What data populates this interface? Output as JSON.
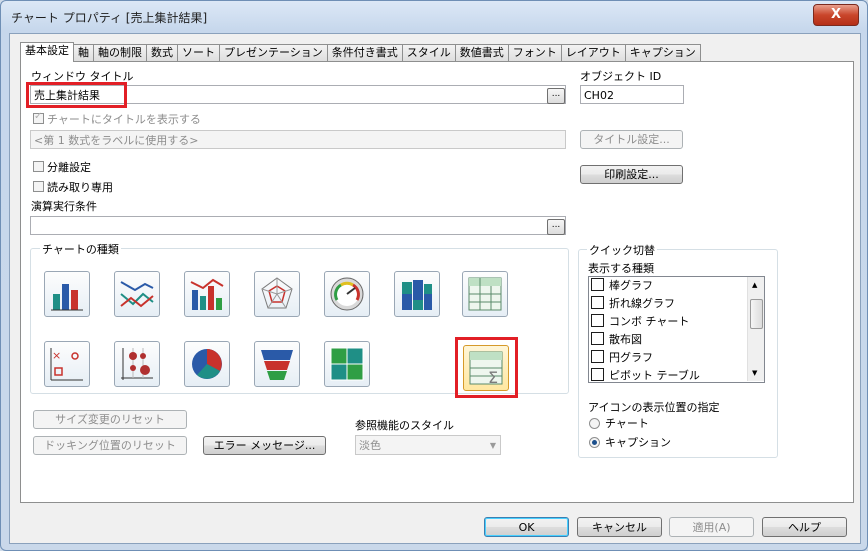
{
  "window": {
    "title": "チャート プロパティ [売上集計結果]",
    "close_label": "X"
  },
  "tabs": [
    "基本設定",
    "軸",
    "軸の制限",
    "数式",
    "ソート",
    "プレゼンテーション",
    "条件付き書式",
    "スタイル",
    "数値書式",
    "フォント",
    "レイアウト",
    "キャプション"
  ],
  "active_tab": "基本設定",
  "window_title_section": {
    "label": "ウィンドウ タイトル",
    "value": "売上集計結果",
    "browse": "..."
  },
  "object_id": {
    "label": "オブジェクト ID",
    "value": "CH02"
  },
  "show_title": {
    "label": "チャートにタイトルを表示する",
    "checked": true,
    "disabled": true
  },
  "title_field": {
    "placeholder": "<第 1 数式をラベルに使用する>"
  },
  "buttons": {
    "title_settings": "タイトル設定...",
    "print_settings": "印刷設定...",
    "resize_reset": "サイズ変更のリセット",
    "docking_reset": "ドッキング位置のリセット",
    "error_messages": "エラー メッセージ...",
    "ok": "OK",
    "cancel": "キャンセル",
    "apply": "適用(A)",
    "help": "ヘルプ"
  },
  "detach": {
    "label": "分離設定",
    "checked": false
  },
  "read_only": {
    "label": "読み取り専用",
    "checked": false
  },
  "calc_condition": {
    "label": "演算実行条件",
    "value": "",
    "browse": "..."
  },
  "chart_types": {
    "label": "チャートの種類",
    "items": [
      "bar-chart",
      "line-chart",
      "combo-chart",
      "radar-chart",
      "gauge-chart",
      "mekko-chart",
      "grid-table-chart",
      "scatter-chart",
      "grid-chart",
      "pie-chart",
      "funnel-chart",
      "block-chart",
      "straight-table-chart"
    ],
    "selected": "straight-table-chart",
    "colors": {
      "blue": "#2a5aa8",
      "teal": "#1f8f86",
      "green": "#2f9e44",
      "red": "#c8322c",
      "highlight": "#e21f26"
    }
  },
  "quick_switch": {
    "label": "クイック切替",
    "types_label": "表示する種類",
    "types": [
      "棒グラフ",
      "折れ線グラフ",
      "コンボ チャート",
      "散布図",
      "円グラフ",
      "ピボット テーブル"
    ]
  },
  "icon_position": {
    "label": "アイコンの表示位置の指定",
    "options": [
      "チャート",
      "キャプション"
    ],
    "selected": "キャプション"
  },
  "reference_style": {
    "label": "参照機能のスタイル",
    "value": "淡色"
  }
}
